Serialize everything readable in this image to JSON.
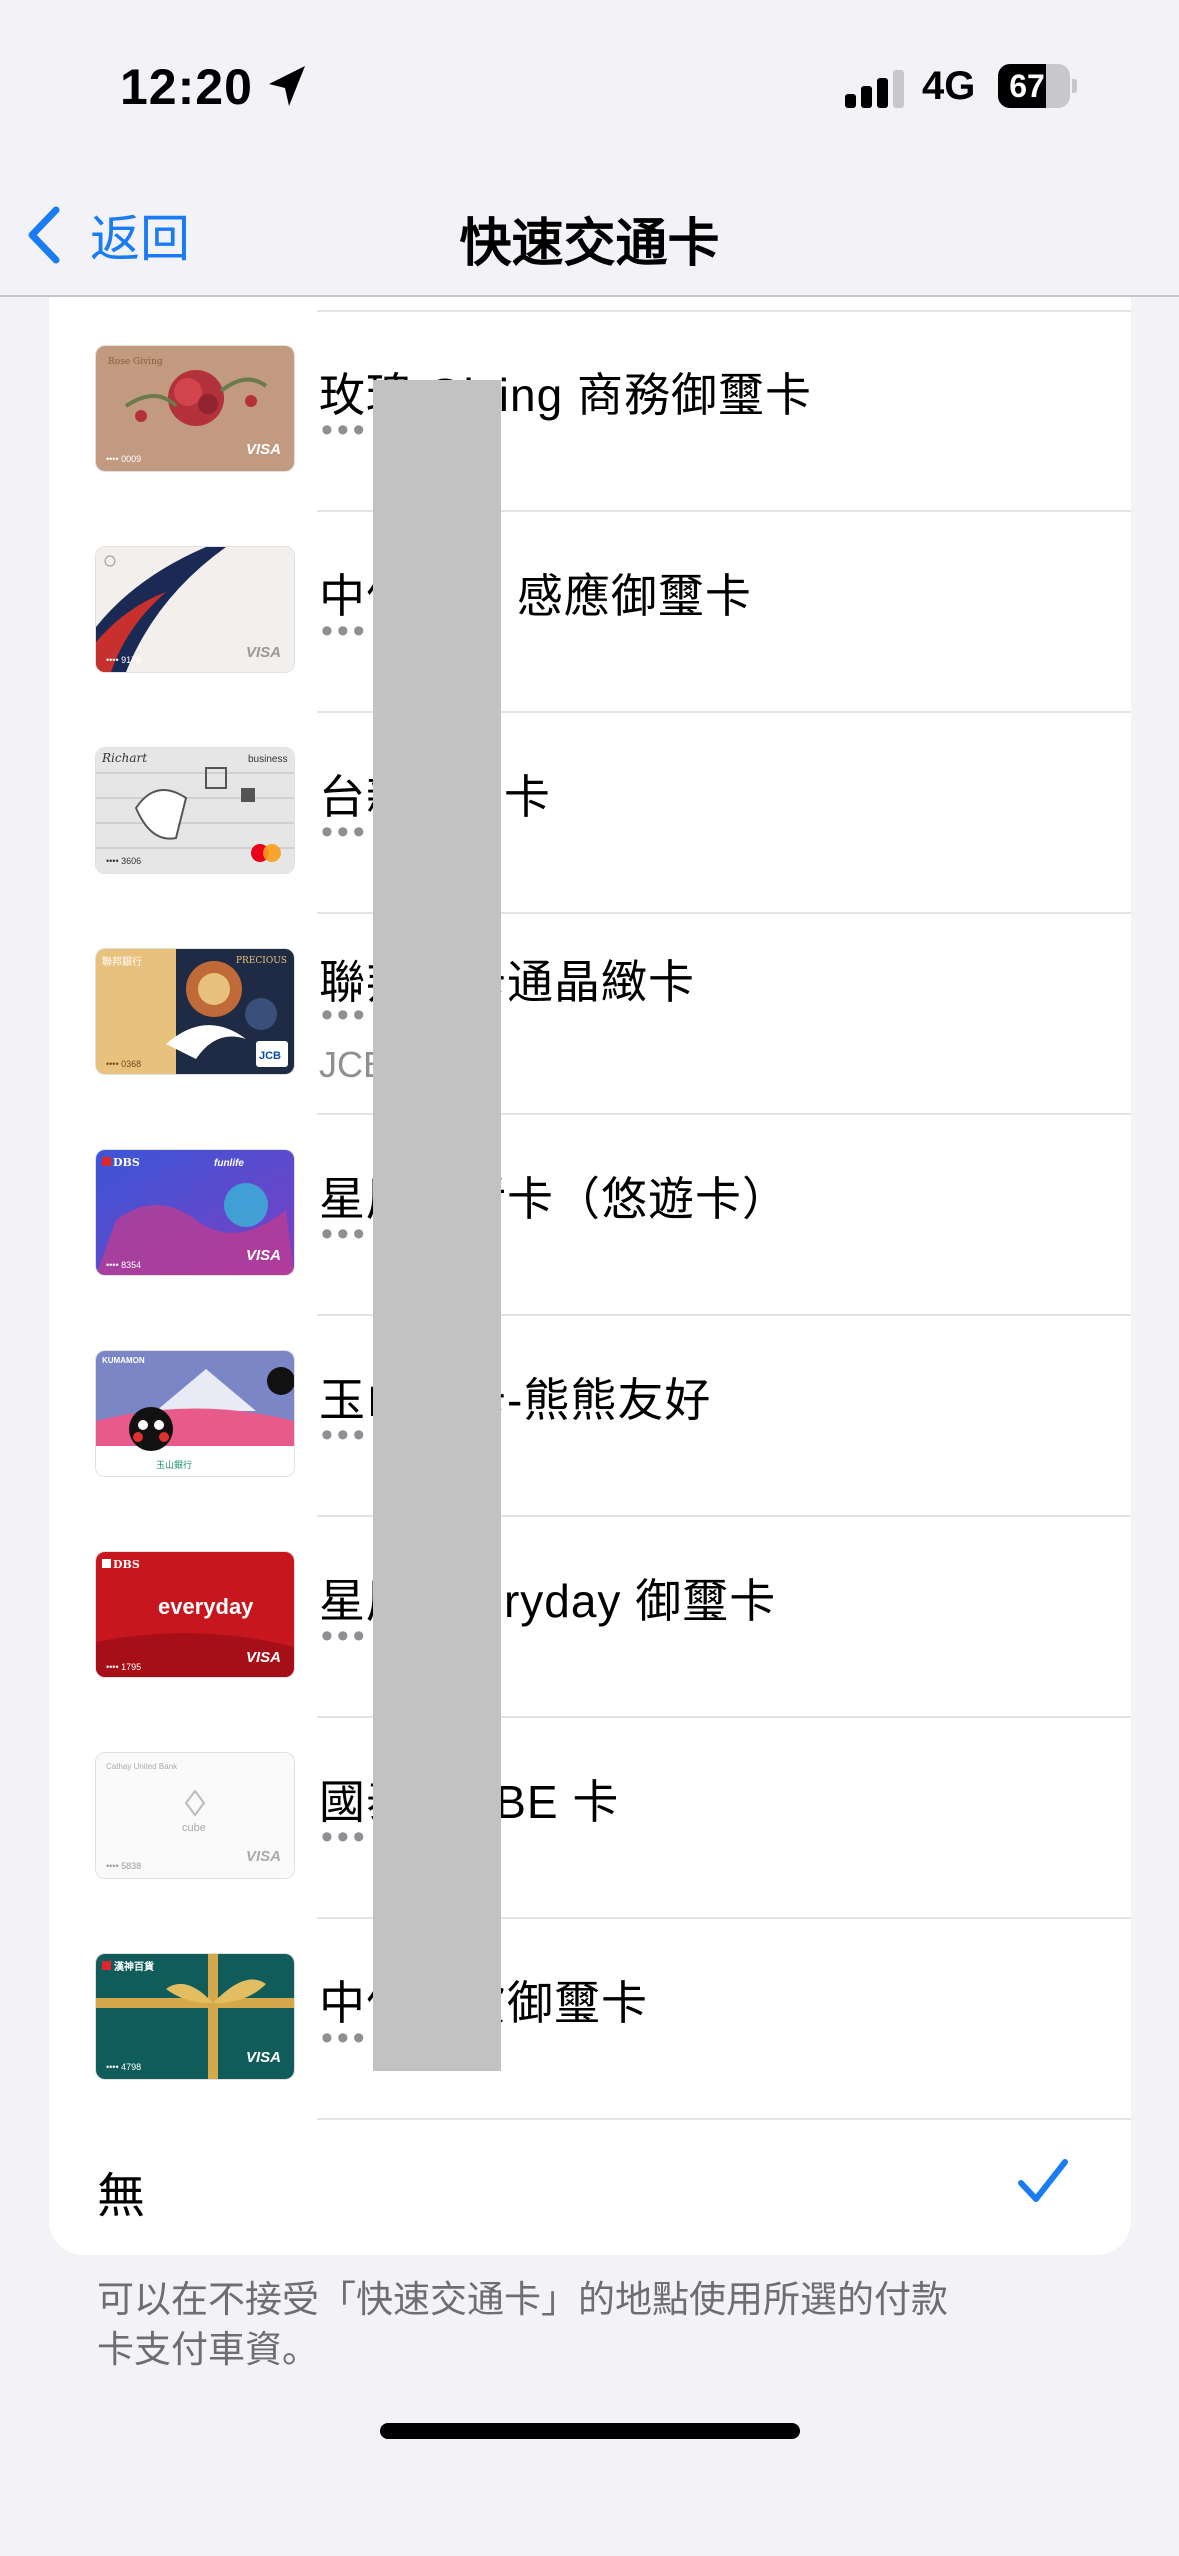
{
  "status_bar": {
    "time": "12:20",
    "network": "4G",
    "battery": "67",
    "battery_level": 0.67
  },
  "nav": {
    "back_label": "返回",
    "title": "快速交通卡"
  },
  "cards": [
    {
      "name": "玫瑰 Giving 商務御璽卡",
      "masked": "•••",
      "art": "rose",
      "thumb_last4": "•••• 0009"
    },
    {
      "name": "中信 VIP 感應御璽卡",
      "masked": "•••",
      "art": "ribbon",
      "thumb_last4": "•••• 9176"
    },
    {
      "name": "台新 Go 卡",
      "masked": "•••",
      "art": "richart",
      "thumb_last4": "•••• 3606"
    },
    {
      "name": "聯邦一卡通晶緻卡",
      "masked": "•••",
      "art": "crane",
      "sub": "JCB",
      "thumb_last4": "•••• 0368"
    },
    {
      "name": "星展生活卡（悠遊卡）",
      "masked": "•••",
      "art": "funlife",
      "thumb_last4": "•••• 8354"
    },
    {
      "name": "玉山熊卡-熊熊友好",
      "masked": "•••",
      "art": "kumamon",
      "thumb_last4": ""
    },
    {
      "name": "星展 everyday 御璽卡",
      "masked": "•••",
      "art": "everyday",
      "thumb_last4": "•••• 1795"
    },
    {
      "name": "國泰 CUBE 卡",
      "masked": "•••",
      "art": "cube",
      "thumb_last4": "•••• 5838"
    },
    {
      "name": "中信百貨御璽卡",
      "masked": "•••",
      "art": "gift",
      "thumb_last4": "•••• 4798"
    }
  ],
  "thumb_text": {
    "rose_brand": "VISA",
    "rose_name": "Rose Giving",
    "ribbon_brand": "VISA",
    "richart_logo": "Richart",
    "richart_tag": "business",
    "crane_bank": "聯邦銀行",
    "crane_tag": "PRECIOUS",
    "crane_brand": "JCB",
    "funlife_bank": "DBS",
    "funlife_tag": "funlife",
    "funlife_brand": "VISA",
    "kumamon_tag": "KUMAMON",
    "kumamon_bank": "玉山銀行",
    "everyday_bank": "DBS",
    "everyday_word": "everyday",
    "everyday_brand": "VISA",
    "cube_bank": "Cathay United Bank",
    "cube_word": "cube",
    "cube_brand": "VISA",
    "gift_store": "漢神百貨",
    "gift_brand": "VISA"
  },
  "none_option": {
    "label": "無",
    "selected": true
  },
  "footer": {
    "note_line1": "可以在不接受「快速交通卡」的地點使用所選的付款",
    "note_line2": "卡支付車資。"
  },
  "colors": {
    "accent": "#1a7cf4",
    "background": "#f2f2f7",
    "secondary_text": "#8e8e93"
  }
}
